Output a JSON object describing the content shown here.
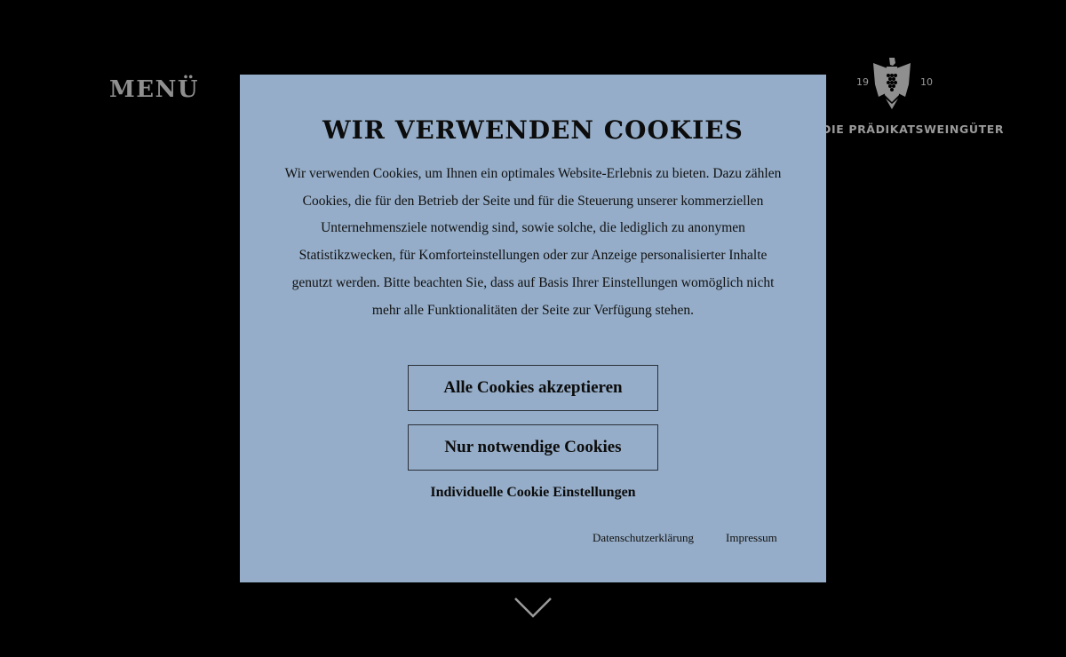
{
  "header": {
    "menu_label": "MENÜ"
  },
  "logo": {
    "year_left": "19",
    "year_right": "10",
    "name": "DIE PRÄDIKATSWEINGÜTER",
    "icon": "eagle-grapes-icon"
  },
  "cookie_modal": {
    "title": "WIR VERWENDEN COOKIES",
    "text": "Wir verwenden Cookies, um Ihnen ein optimales Website-Erlebnis zu bieten. Dazu zählen Cookies, die für den Betrieb der Seite und für die Steuerung unserer kommerziellen Unternehmensziele notwendig sind, sowie solche, die lediglich zu anonymen Statistikzwecken, für Komforteinstellungen oder zur Anzeige personalisierter Inhalte genutzt werden. Bitte beachten Sie, dass auf Basis Ihrer Einstellungen womöglich nicht mehr alle Funktionalitäten der Seite zur Verfügung stehen.",
    "accept_all_label": "Alle Cookies akzeptieren",
    "necessary_only_label": "Nur notwendige Cookies",
    "individual_settings_label": "Individuelle Cookie Einstellungen",
    "privacy_link": "Datenschutzerklärung",
    "imprint_link": "Impressum",
    "background_color": "#95adc8"
  },
  "scroll_hint": {
    "icon": "chevron-down-icon"
  }
}
